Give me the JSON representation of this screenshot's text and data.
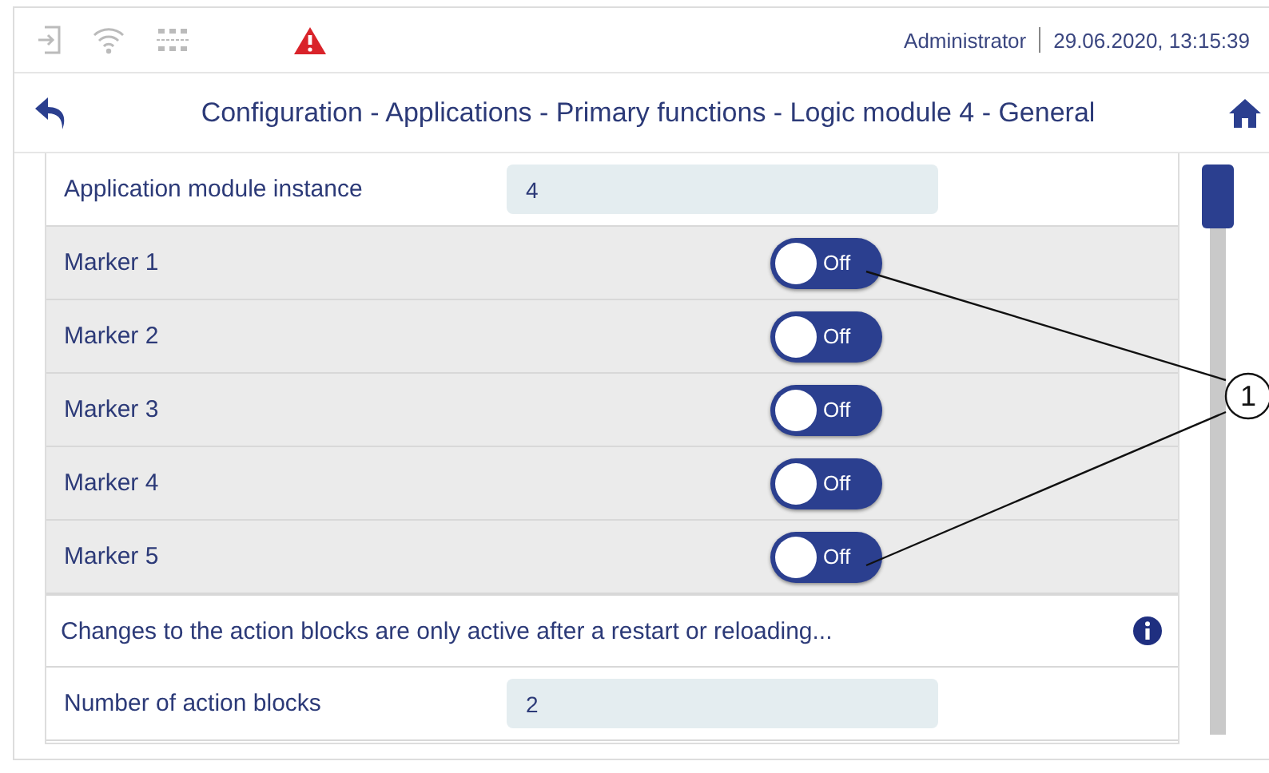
{
  "status_bar": {
    "user": "Administrator",
    "datetime": "29.06.2020, 13:15:39"
  },
  "nav": {
    "title": "Configuration - Applications - Primary functions - Logic module 4 - General"
  },
  "rows": [
    {
      "kind": "field",
      "label": "Application module instance",
      "value": "4"
    },
    {
      "kind": "toggle",
      "label": "Marker 1",
      "on": false,
      "state_label": "Off"
    },
    {
      "kind": "toggle",
      "label": "Marker 2",
      "on": false,
      "state_label": "Off"
    },
    {
      "kind": "toggle",
      "label": "Marker 3",
      "on": false,
      "state_label": "Off"
    },
    {
      "kind": "toggle",
      "label": "Marker 4",
      "on": false,
      "state_label": "Off"
    },
    {
      "kind": "toggle",
      "label": "Marker 5",
      "on": false,
      "state_label": "Off"
    },
    {
      "kind": "notice",
      "label": "Changes to the action blocks are only active after a restart or reloading..."
    },
    {
      "kind": "field",
      "label": "Number of action blocks",
      "value": "2"
    }
  ],
  "callout": {
    "label": "1"
  }
}
